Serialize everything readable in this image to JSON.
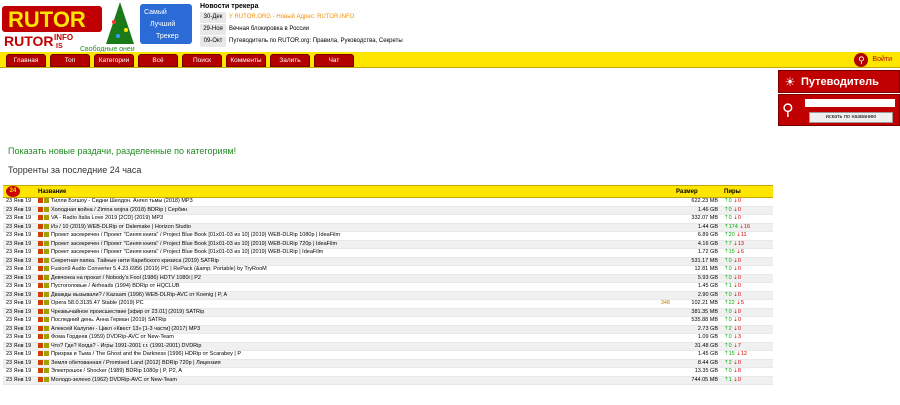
{
  "logo": {
    "text": "RUTOR",
    "suffix": "INFO",
    "sub": "IS",
    "tag1": "Самый",
    "tag2": "Лучший",
    "tag3": "Трекер",
    "slogan": "Свободные онеи"
  },
  "news": {
    "title": "Новости трекера",
    "items": [
      {
        "date": "30-Дек",
        "text": "У RUTOR.ORG - Новый Адрес: RUTOR.INFO"
      },
      {
        "date": "29-Ноя",
        "text": "Вечная блокировка в России"
      },
      {
        "date": "09-Окт",
        "text": "Путеводитель по RUTOR.org: Правила, Руководства, Секреты"
      }
    ]
  },
  "menu": [
    "Главная",
    "Топ",
    "Категории",
    "Всё",
    "Поиск",
    "Комменты",
    "Залить",
    "Чат"
  ],
  "login": "Войти",
  "guide": "Путеводитель",
  "search": {
    "button": "искать по названию"
  },
  "main": {
    "new_by_cat": "Показать новые раздачи, разделенные по категориям!",
    "last24": "Торренты за последние 24 часа"
  },
  "table": {
    "badge": "24",
    "headers": {
      "name": "Название",
      "size": "Размер",
      "peers": "Пиры"
    },
    "rows": [
      {
        "date": "23 Янв 19",
        "title": "Тилли Бэгшоу - Сидни Шелдон. Ангел тьмы (2018) MP3",
        "comments": "",
        "size": "622.23 MB",
        "up": "0",
        "down": "0"
      },
      {
        "date": "23 Янв 19",
        "title": "Холодная война / Zimna wojna (2018) BDRip | Сербин",
        "comments": "",
        "size": "1.46 GB",
        "up": "0",
        "down": "0"
      },
      {
        "date": "23 Янв 19",
        "title": "VA - Radio Italia Love 2019 [2CD] (2019) MP3",
        "comments": "",
        "size": "332.07 MB",
        "up": "0",
        "down": "0"
      },
      {
        "date": "23 Янв 19",
        "title": "Иэ / 10 (2019) WEB-DLRip от Dalemake | Horizon Studio",
        "comments": "",
        "size": "1.44 GB",
        "up": "174",
        "down": "16"
      },
      {
        "date": "23 Янв 19",
        "title": "Проект засекречен / Проект \"Синяя книга\" / Project Blue Book [01x01-03 из 10] (2019) WEB-DLRip 1080p | IdeaFilm",
        "comments": "",
        "size": "6.89 GB",
        "up": "20",
        "down": "11"
      },
      {
        "date": "23 Янв 19",
        "title": "Проект засекречен / Проект \"Синяя книга\" / Project Blue Book [01x01-03 из 10] (2019) WEB-DLRip 720p | IdeaFilm",
        "comments": "",
        "size": "4.16 GB",
        "up": "7",
        "down": "13"
      },
      {
        "date": "23 Янв 19",
        "title": "Проект засекречен / Проект \"Синяя книга\" / Project Blue Book [01x01-03 из 10] (2019) WEB-DLRip | IdeaFilm",
        "comments": "",
        "size": "1.72 GB",
        "up": "15",
        "down": "6"
      },
      {
        "date": "23 Янв 19",
        "title": "Секретная папка. Тайные нити Карибского кризиса (2019) SATRip",
        "comments": "",
        "size": "531.17 MB",
        "up": "0",
        "down": "0"
      },
      {
        "date": "23 Янв 19",
        "title": "Fusion9 Audio Converter 5.4.23.6956 (2019) PC | RePack (&amp; Portable) by TryRooM",
        "comments": "",
        "size": "12.81 MB",
        "up": "0",
        "down": "0"
      },
      {
        "date": "23 Янв 19",
        "title": "Девчонка на прокат / Nobody's Fool (1986) HDTV 1080i | P2",
        "comments": "",
        "size": "5.93 GB",
        "up": "0",
        "down": "0"
      },
      {
        "date": "23 Янв 19",
        "title": "Пустоголовые / Airheads (1994) BDRip от HQCLUB",
        "comments": "",
        "size": "1.45 GB",
        "up": "1",
        "down": "0"
      },
      {
        "date": "23 Янв 19",
        "title": "Дважды вызывали? / Kazaam (1996) WEB-DLRip-AVC от Koenig | P, A",
        "comments": "",
        "size": "2.90 GB",
        "up": "0",
        "down": "0"
      },
      {
        "date": "23 Янв 19",
        "title": "Opera 58.0.3135.47 Stable (2019) PC",
        "comments": "348",
        "size": "102.21 MB",
        "up": "22",
        "down": "5"
      },
      {
        "date": "23 Янв 19",
        "title": "Чрезвычайное происшествие [эфир от 23.01] (2019) SATRip",
        "comments": "",
        "size": "381.35 MB",
        "up": "0",
        "down": "0"
      },
      {
        "date": "23 Янв 19",
        "title": "Последний день. Анна Герман (2019) SATRip",
        "comments": "",
        "size": "535.88 MB",
        "up": "0",
        "down": "0"
      },
      {
        "date": "23 Янв 19",
        "title": "Алексей Калугин - Цикл «Квест 13» [1-3 части] (2017) MP3",
        "comments": "",
        "size": "2.73 GB",
        "up": "2",
        "down": "0"
      },
      {
        "date": "23 Янв 19",
        "title": "Фома Гордеев (1959) DVDRip-AVC от New-Team",
        "comments": "",
        "size": "1.09 GB",
        "up": "0",
        "down": "3"
      },
      {
        "date": "23 Янв 19",
        "title": "Что? Где? Когда? - Игры 1991-2001 г.г. (1991-2001) DVDRip",
        "comments": "",
        "size": "31.48 GB",
        "up": "0",
        "down": "7"
      },
      {
        "date": "23 Янв 19",
        "title": "Призрак и Тьма / The Ghost and the Darkness (1996) HDRip от Scarabey | P",
        "comments": "",
        "size": "1.45 GB",
        "up": "15",
        "down": "12"
      },
      {
        "date": "23 Янв 19",
        "title": "Земля обетованная / Promised Land (2012) BDRip 720p | Лицензия",
        "comments": "",
        "size": "8.44 GB",
        "up": "2",
        "down": "0"
      },
      {
        "date": "23 Янв 19",
        "title": "Электрошок / Shocker (1989) BDRip 1080p | P, P2, A",
        "comments": "",
        "size": "13.35 GB",
        "up": "0",
        "down": "8"
      },
      {
        "date": "23 Янв 19",
        "title": "Молодо-зелено (1962) DVDRip-AVC от New-Team",
        "comments": "",
        "size": "744.05 MB",
        "up": "1",
        "down": "0"
      }
    ]
  }
}
